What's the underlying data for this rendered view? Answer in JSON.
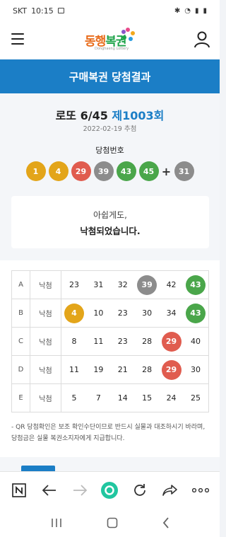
{
  "status_bar": {
    "carrier": "SKT",
    "time": "10:15"
  },
  "header": {
    "logo_text_a": "동행",
    "logo_text_b": "복권",
    "logo_sub": "Donghaeng Lottery"
  },
  "band": {
    "title": "구매복권 당첨결과"
  },
  "round": {
    "prefix": "로또 6/45",
    "number": "제1003회",
    "date": "2022-02-19 추첨"
  },
  "winning": {
    "label": "당첨번호",
    "numbers": [
      {
        "value": "1",
        "color": "#e3a51a"
      },
      {
        "value": "4",
        "color": "#e3a51a"
      },
      {
        "value": "29",
        "color": "#e05c4f"
      },
      {
        "value": "39",
        "color": "#8c8c8c"
      },
      {
        "value": "43",
        "color": "#4aa64a"
      },
      {
        "value": "45",
        "color": "#4aa64a"
      }
    ],
    "plus": "+",
    "bonus": {
      "value": "31",
      "color": "#8c8c8c"
    }
  },
  "result": {
    "line1": "아쉽게도,",
    "line2": "낙첨되었습니다."
  },
  "games": [
    {
      "game": "A",
      "status": "낙첨",
      "numbers": [
        "23",
        "31",
        "32",
        "39",
        "42",
        "43"
      ],
      "hits": [
        null,
        null,
        null,
        "#8c8c8c",
        null,
        "#4aa64a"
      ]
    },
    {
      "game": "B",
      "status": "낙첨",
      "numbers": [
        "4",
        "10",
        "23",
        "30",
        "34",
        "43"
      ],
      "hits": [
        "#e3a51a",
        null,
        null,
        null,
        null,
        "#4aa64a"
      ]
    },
    {
      "game": "C",
      "status": "낙첨",
      "numbers": [
        "8",
        "11",
        "23",
        "28",
        "29",
        "40"
      ],
      "hits": [
        null,
        null,
        null,
        null,
        "#e05c4f",
        null
      ]
    },
    {
      "game": "D",
      "status": "낙첨",
      "numbers": [
        "11",
        "19",
        "21",
        "28",
        "29",
        "30"
      ],
      "hits": [
        null,
        null,
        null,
        null,
        "#e05c4f",
        null
      ]
    },
    {
      "game": "E",
      "status": "낙첨",
      "numbers": [
        "5",
        "7",
        "14",
        "15",
        "24",
        "25"
      ],
      "hits": [
        null,
        null,
        null,
        null,
        null,
        null
      ]
    }
  ],
  "notice": "- QR 당첨확인은 보조 확인수단이므로 반드시 실물과 대조하시기 바라며, 당첨금은 실물 복권소지자에게 지급합니다.",
  "icons": {
    "menu": "hamburger-icon",
    "user": "user-icon",
    "home": "n-home-icon",
    "back": "arrow-left-icon",
    "forward": "arrow-right-icon",
    "center": "whale-icon",
    "reload": "reload-icon",
    "share": "share-icon",
    "more": "more-icon"
  }
}
